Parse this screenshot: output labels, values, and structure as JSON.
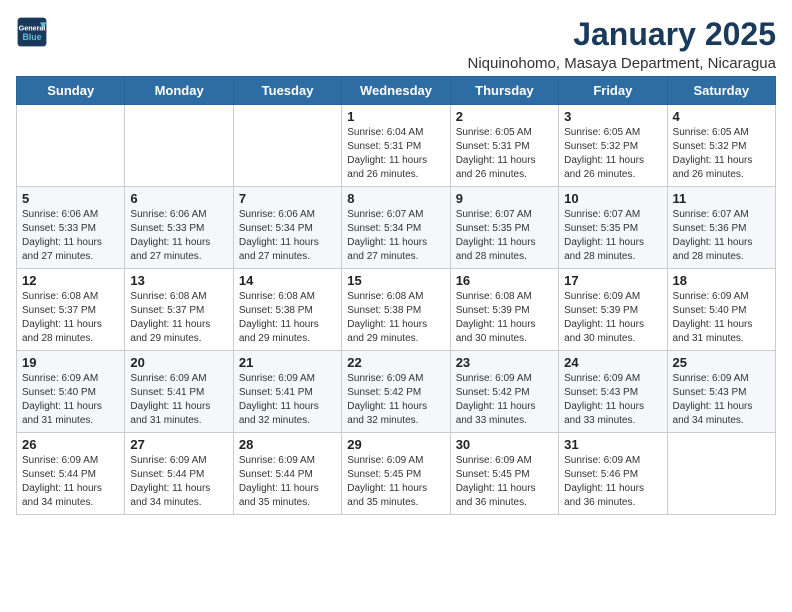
{
  "header": {
    "logo_line1": "General",
    "logo_line2": "Blue",
    "month": "January 2025",
    "location": "Niquinohomo, Masaya Department, Nicaragua"
  },
  "days_of_week": [
    "Sunday",
    "Monday",
    "Tuesday",
    "Wednesday",
    "Thursday",
    "Friday",
    "Saturday"
  ],
  "weeks": [
    [
      {
        "day": "",
        "info": ""
      },
      {
        "day": "",
        "info": ""
      },
      {
        "day": "",
        "info": ""
      },
      {
        "day": "1",
        "info": "Sunrise: 6:04 AM\nSunset: 5:31 PM\nDaylight: 11 hours and 26 minutes."
      },
      {
        "day": "2",
        "info": "Sunrise: 6:05 AM\nSunset: 5:31 PM\nDaylight: 11 hours and 26 minutes."
      },
      {
        "day": "3",
        "info": "Sunrise: 6:05 AM\nSunset: 5:32 PM\nDaylight: 11 hours and 26 minutes."
      },
      {
        "day": "4",
        "info": "Sunrise: 6:05 AM\nSunset: 5:32 PM\nDaylight: 11 hours and 26 minutes."
      }
    ],
    [
      {
        "day": "5",
        "info": "Sunrise: 6:06 AM\nSunset: 5:33 PM\nDaylight: 11 hours and 27 minutes."
      },
      {
        "day": "6",
        "info": "Sunrise: 6:06 AM\nSunset: 5:33 PM\nDaylight: 11 hours and 27 minutes."
      },
      {
        "day": "7",
        "info": "Sunrise: 6:06 AM\nSunset: 5:34 PM\nDaylight: 11 hours and 27 minutes."
      },
      {
        "day": "8",
        "info": "Sunrise: 6:07 AM\nSunset: 5:34 PM\nDaylight: 11 hours and 27 minutes."
      },
      {
        "day": "9",
        "info": "Sunrise: 6:07 AM\nSunset: 5:35 PM\nDaylight: 11 hours and 28 minutes."
      },
      {
        "day": "10",
        "info": "Sunrise: 6:07 AM\nSunset: 5:35 PM\nDaylight: 11 hours and 28 minutes."
      },
      {
        "day": "11",
        "info": "Sunrise: 6:07 AM\nSunset: 5:36 PM\nDaylight: 11 hours and 28 minutes."
      }
    ],
    [
      {
        "day": "12",
        "info": "Sunrise: 6:08 AM\nSunset: 5:37 PM\nDaylight: 11 hours and 28 minutes."
      },
      {
        "day": "13",
        "info": "Sunrise: 6:08 AM\nSunset: 5:37 PM\nDaylight: 11 hours and 29 minutes."
      },
      {
        "day": "14",
        "info": "Sunrise: 6:08 AM\nSunset: 5:38 PM\nDaylight: 11 hours and 29 minutes."
      },
      {
        "day": "15",
        "info": "Sunrise: 6:08 AM\nSunset: 5:38 PM\nDaylight: 11 hours and 29 minutes."
      },
      {
        "day": "16",
        "info": "Sunrise: 6:08 AM\nSunset: 5:39 PM\nDaylight: 11 hours and 30 minutes."
      },
      {
        "day": "17",
        "info": "Sunrise: 6:09 AM\nSunset: 5:39 PM\nDaylight: 11 hours and 30 minutes."
      },
      {
        "day": "18",
        "info": "Sunrise: 6:09 AM\nSunset: 5:40 PM\nDaylight: 11 hours and 31 minutes."
      }
    ],
    [
      {
        "day": "19",
        "info": "Sunrise: 6:09 AM\nSunset: 5:40 PM\nDaylight: 11 hours and 31 minutes."
      },
      {
        "day": "20",
        "info": "Sunrise: 6:09 AM\nSunset: 5:41 PM\nDaylight: 11 hours and 31 minutes."
      },
      {
        "day": "21",
        "info": "Sunrise: 6:09 AM\nSunset: 5:41 PM\nDaylight: 11 hours and 32 minutes."
      },
      {
        "day": "22",
        "info": "Sunrise: 6:09 AM\nSunset: 5:42 PM\nDaylight: 11 hours and 32 minutes."
      },
      {
        "day": "23",
        "info": "Sunrise: 6:09 AM\nSunset: 5:42 PM\nDaylight: 11 hours and 33 minutes."
      },
      {
        "day": "24",
        "info": "Sunrise: 6:09 AM\nSunset: 5:43 PM\nDaylight: 11 hours and 33 minutes."
      },
      {
        "day": "25",
        "info": "Sunrise: 6:09 AM\nSunset: 5:43 PM\nDaylight: 11 hours and 34 minutes."
      }
    ],
    [
      {
        "day": "26",
        "info": "Sunrise: 6:09 AM\nSunset: 5:44 PM\nDaylight: 11 hours and 34 minutes."
      },
      {
        "day": "27",
        "info": "Sunrise: 6:09 AM\nSunset: 5:44 PM\nDaylight: 11 hours and 34 minutes."
      },
      {
        "day": "28",
        "info": "Sunrise: 6:09 AM\nSunset: 5:44 PM\nDaylight: 11 hours and 35 minutes."
      },
      {
        "day": "29",
        "info": "Sunrise: 6:09 AM\nSunset: 5:45 PM\nDaylight: 11 hours and 35 minutes."
      },
      {
        "day": "30",
        "info": "Sunrise: 6:09 AM\nSunset: 5:45 PM\nDaylight: 11 hours and 36 minutes."
      },
      {
        "day": "31",
        "info": "Sunrise: 6:09 AM\nSunset: 5:46 PM\nDaylight: 11 hours and 36 minutes."
      },
      {
        "day": "",
        "info": ""
      }
    ]
  ]
}
